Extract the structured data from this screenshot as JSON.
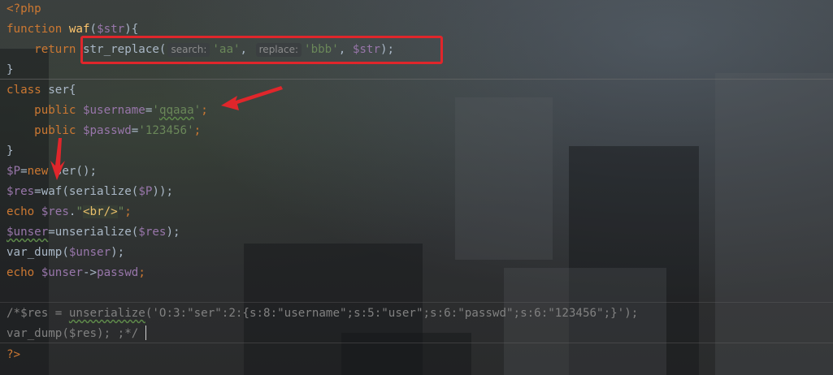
{
  "code": {
    "l1": {
      "open": "<?php"
    },
    "l2": {
      "kw": "function",
      "name": "waf",
      "p1": "(",
      "var": "$str",
      "p2": "){"
    },
    "l3": {
      "kw": "return",
      "fn": "str_replace(",
      "hint1": "search:",
      "s1": "'aa'",
      "comma1": ",",
      "hint2": "replace:",
      "s2": "'bbb'",
      "comma2": ",",
      "var": "$str",
      "end": ");"
    },
    "l4": {
      "close": "}"
    },
    "l5": {
      "kw": "class",
      "name": "ser{"
    },
    "l6": {
      "kw": "public",
      "var": "$username",
      "eq": "=",
      "q1": "'",
      "val": "qqaaa",
      "q2": "'",
      "semi": ";"
    },
    "l7": {
      "kw": "public",
      "var": "$passwd",
      "eq": "=",
      "val": "'123456'",
      "semi": ";"
    },
    "l8": {
      "close": "}"
    },
    "l9": {
      "var": "$P",
      "eq": "=",
      "kw": "new",
      "rest": "ser();"
    },
    "l10": {
      "var": "$res",
      "eq": "=",
      "rest1": "waf(serialize(",
      "var2": "$P",
      "rest2": "));"
    },
    "l11": {
      "kw": "echo",
      "var": "$res",
      "dot": ".",
      "q1": "\"",
      "tag": "<br/>",
      "q2": "\"",
      "semi": ";"
    },
    "l12": {
      "var": "$unser",
      "eq": "=",
      "rest1": "unserialize(",
      "var2": "$res",
      "rest2": ");"
    },
    "l13": {
      "fn": "var_dump(",
      "var": "$unser",
      "rest": ");"
    },
    "l14": {
      "kw": "echo",
      "var": "$unser",
      "arrow": "->",
      "prop": "passwd",
      "semi": ";"
    },
    "l16": {
      "c1": "/*$res = ",
      "c2": "unserialize",
      "c3": "('O:3:\"ser\":2:{s:8:\"username\";s:5:\"user\";s:6:\"passwd\";s:6:\"123456\";}');"
    },
    "l17": {
      "c": "var_dump($res); ;*/"
    },
    "l18": {
      "close": "?>"
    }
  },
  "colors": {
    "keyword": "#cc7832",
    "function": "#ffc66d",
    "variable": "#9876aa",
    "string": "#6a8759",
    "plain": "#a9b7c6",
    "comment": "#808080",
    "annotation_red": "#e0262b"
  }
}
